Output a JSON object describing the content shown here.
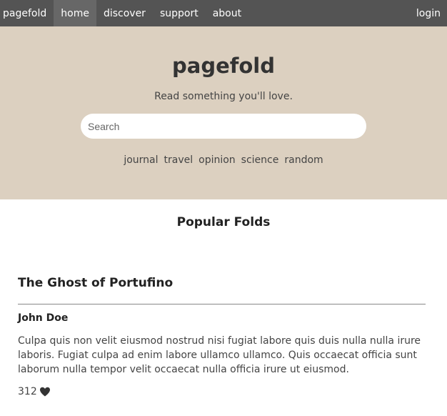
{
  "nav": {
    "brand": "pagefold",
    "items": [
      {
        "label": "home"
      },
      {
        "label": "discover"
      },
      {
        "label": "support"
      },
      {
        "label": "about"
      }
    ],
    "login": "login"
  },
  "hero": {
    "title": "pagefold",
    "tagline": "Read something you'll love.",
    "search_placeholder": "Search",
    "categories": [
      "journal",
      "travel",
      "opinion",
      "science",
      "random"
    ]
  },
  "main": {
    "section_title": "Popular Folds",
    "post": {
      "title": "The Ghost of Portufino",
      "author": "John Doe",
      "body": "Culpa quis non velit eiusmod nostrud nisi fugiat labore quis duis nulla nulla irure laboris. Fugiat culpa ad enim labore ullamco ullamco. Quis occaecat officia sunt laborum nulla tempor velit occaecat nulla officia irure ut eiusmod.",
      "likes": "312",
      "like_icon": "heart-icon"
    }
  },
  "colors": {
    "navbar": "#545454",
    "nav_active": "#676767",
    "hero_bg": "#dcd0c0"
  }
}
